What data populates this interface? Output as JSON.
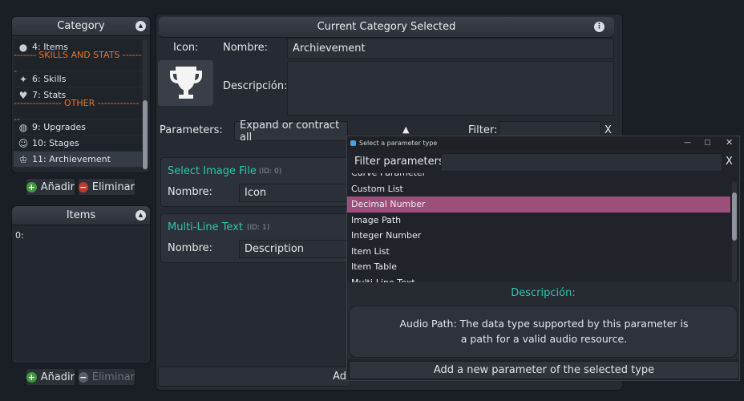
{
  "category_panel": {
    "title": "Category",
    "items": [
      {
        "label": "4: Items",
        "icon": "sack-icon",
        "kind": "item"
      },
      {
        "label": "------- SKILLS AND STATS -------",
        "kind": "separator"
      },
      {
        "label": "6: Skills",
        "icon": "sparkle-icon",
        "kind": "item"
      },
      {
        "label": "7: Stats",
        "icon": "heart-icon",
        "kind": "item"
      },
      {
        "label": "--------------- OTHER ---------------",
        "kind": "separator"
      },
      {
        "label": "9: Upgrades",
        "icon": "globe-icon",
        "kind": "item"
      },
      {
        "label": "10: Stages",
        "icon": "people-icon",
        "kind": "item"
      },
      {
        "label": "11: Archievement",
        "icon": "trophy-icon",
        "kind": "item",
        "selected": true
      }
    ],
    "add_label": "Añadir",
    "remove_label": "Eliminar"
  },
  "items_panel": {
    "title": "Items",
    "items": [
      "0:"
    ],
    "add_label": "Añadir",
    "remove_label": "Eliminar"
  },
  "main_panel": {
    "title": "Current Category Selected",
    "icon_label": "Icon:",
    "name_label": "Nombre:",
    "name_value": "Archievement",
    "desc_label": "Descripción:",
    "parameters_label": "Parameters:",
    "expand_label": "Expand or contract all",
    "expand_arrow": "▲",
    "filter_label": "Filter:",
    "filter_clear": "X",
    "params": [
      {
        "title": "Select Image File",
        "id": "(ID: 0)",
        "name_label": "Nombre:",
        "name_value": "Icon"
      },
      {
        "title": "Multi-Line Text",
        "id": "(ID: 1)",
        "name_label": "Nombre:",
        "name_value": "Description"
      }
    ],
    "add_param_partial": "Ad"
  },
  "dialog": {
    "title": "Select a parameter type",
    "filter_label": "Filter parameters:",
    "filter_clear": "X",
    "types": [
      "Curve Parameter",
      "Custom List",
      "Decimal Number",
      "Image Path",
      "Integer Number",
      "Item List",
      "Item Table",
      "Multi-Line Text"
    ],
    "selected_type": "Decimal Number",
    "desc_header": "Descripción:",
    "desc_line1": "Audio Path: The data type supported by this parameter is",
    "desc_line2": "a path for a valid audio resource.",
    "add_button": "Add a new parameter of the selected type"
  },
  "colors": {
    "accent_teal": "#2bc6ae",
    "separator_orange": "#e0752d",
    "selection_pink": "#9d4f7c"
  }
}
